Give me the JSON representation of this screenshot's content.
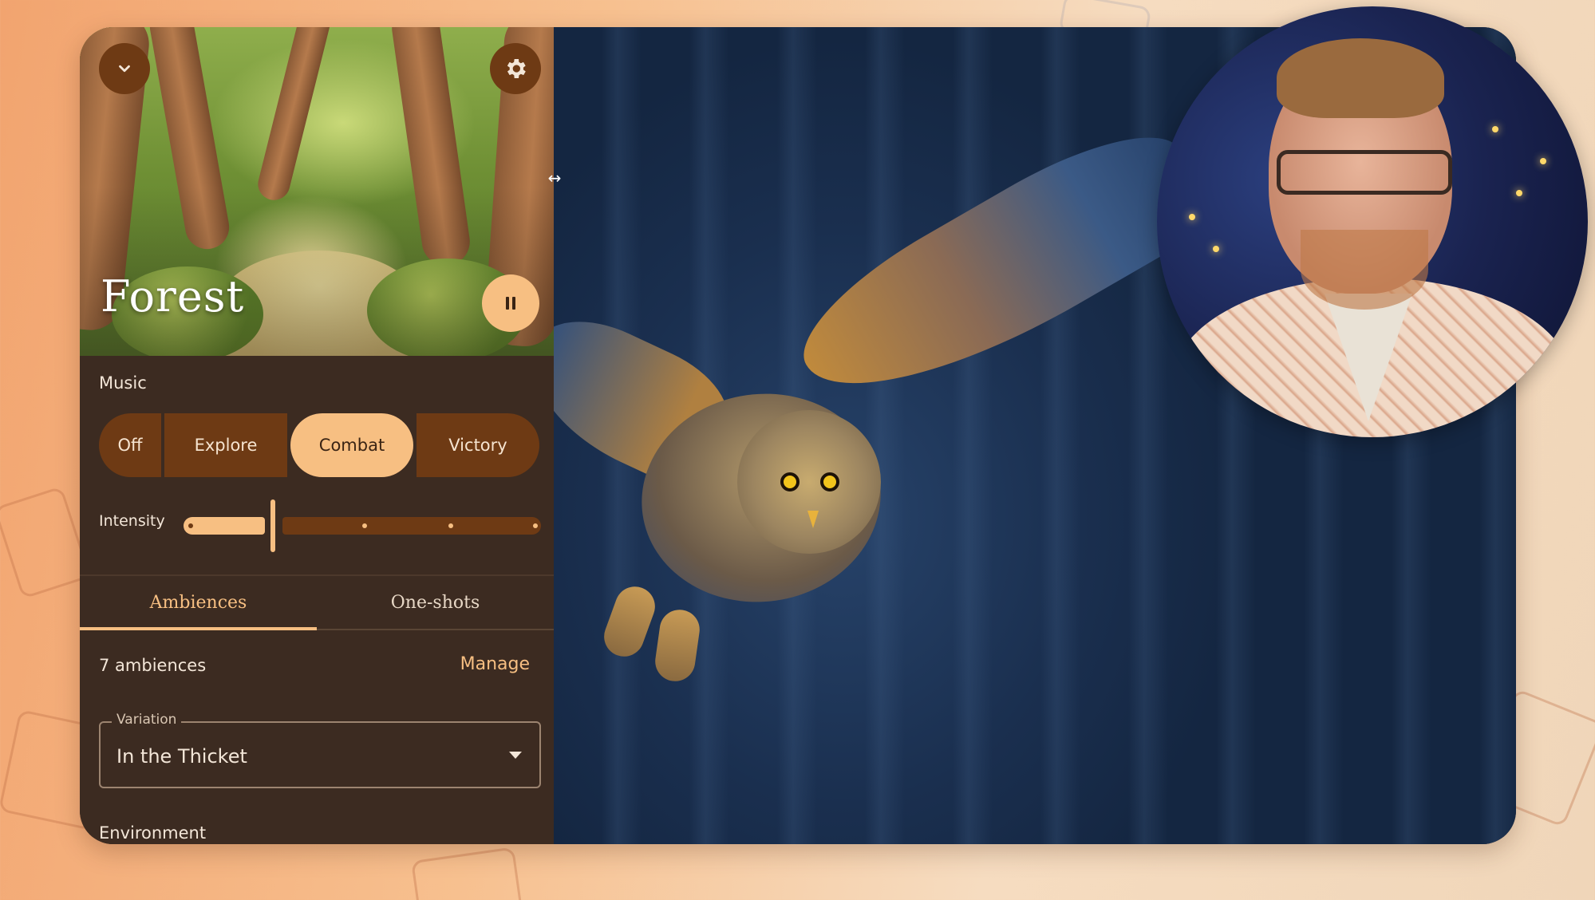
{
  "panel": {
    "scene_title": "Forest",
    "collapse_icon": "chevron-down-icon",
    "settings_icon": "gear-icon",
    "pause_icon": "pause-icon",
    "music": {
      "label": "Music",
      "options": [
        "Off",
        "Explore",
        "Combat",
        "Victory"
      ],
      "selected": "Combat"
    },
    "intensity": {
      "label": "Intensity",
      "level": 0.25
    },
    "tabs": [
      {
        "label": "Ambiences",
        "active": true
      },
      {
        "label": "One-shots",
        "active": false
      }
    ],
    "ambiences_count": "7 ambiences",
    "manage_label": "Manage",
    "variation": {
      "label": "Variation",
      "value": "In the Thicket"
    },
    "environment_label": "Environment"
  },
  "colors": {
    "accent": "#f7bf82",
    "button_dark": "#6e3a14",
    "panel_bg": "#3c2b21"
  }
}
